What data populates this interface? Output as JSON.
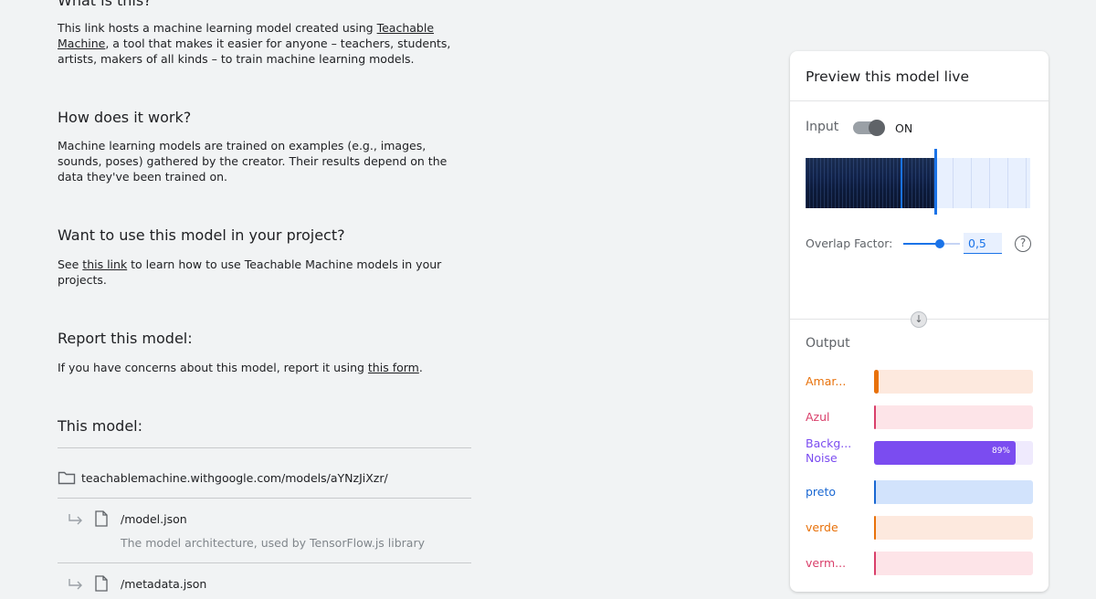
{
  "left": {
    "what_title": "What is this?",
    "what_text_1": "This link hosts a machine learning model created using ",
    "what_link": "Teachable Machine",
    "what_text_2": ", a tool that makes it easier for anyone – teachers, students, artists, makers of all kinds – to train machine learning models.",
    "how_title": "How does it work?",
    "how_text": "Machine learning models are trained on examples (e.g., images, sounds, poses) gathered by the creator. Their results depend on the data they've been trained on.",
    "use_title": "Want to use this model in your project?",
    "use_text_1": "See ",
    "use_link": "this link",
    "use_text_2": " to learn how to use Teachable Machine models in your projects.",
    "report_title": "Report this model:",
    "report_text_1": "If you have concerns about this model, report it using ",
    "report_link": "this form",
    "report_text_2": ".",
    "model_title": "This model:",
    "folder_path": "teachablemachine.withgoogle.com/models/aYNzJiXzr/",
    "files": [
      {
        "name": "/model.json",
        "desc": "The model architecture, used by TensorFlow.js library"
      },
      {
        "name": "/metadata.json",
        "desc": ""
      }
    ]
  },
  "preview": {
    "title": "Preview this model live",
    "input_label": "Input",
    "toggle_state": "ON",
    "overlap_label": "Overlap Factor:",
    "overlap_value": "0,5",
    "overlap_fraction": 0.65,
    "help_glyph": "?",
    "arrow_glyph": "↓",
    "output_label": "Output",
    "outputs": [
      {
        "label": "Amar...",
        "value": 0.03,
        "pct_text": "",
        "color": "#e8710a",
        "bg": "#fde9de"
      },
      {
        "label": "Azul",
        "value": 0.01,
        "pct_text": "",
        "color": "#d93f6a",
        "bg": "#fde4e8"
      },
      {
        "label": "Backg... Noise",
        "value": 0.89,
        "pct_text": "89%",
        "color": "#7b4cf0",
        "bg": "#efeafd"
      },
      {
        "label": "preto",
        "value": 0.01,
        "pct_text": "",
        "color": "#1967d2",
        "bg": "#d2e3fc"
      },
      {
        "label": "verde",
        "value": 0.0,
        "pct_text": "",
        "color": "#e8710a",
        "bg": "#fde9de"
      },
      {
        "label": "verm...",
        "value": 0.005,
        "pct_text": "",
        "color": "#d93f6a",
        "bg": "#fde4e8"
      }
    ]
  }
}
